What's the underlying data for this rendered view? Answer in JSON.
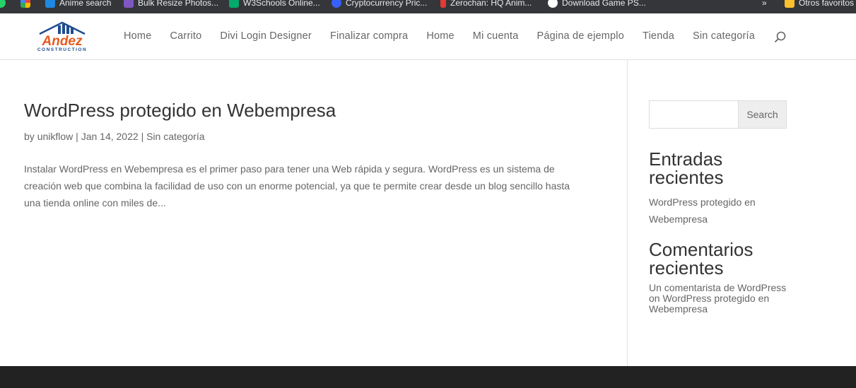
{
  "bookmarks": [
    {
      "icon": "whatsapp-icon",
      "label": "",
      "color": "#25d366"
    },
    {
      "icon": "google-icon",
      "label": "",
      "color": "#ffffff"
    },
    {
      "icon": "anime-search-icon",
      "label": "Anime search",
      "color": "#1e88e5"
    },
    {
      "icon": "bulk-resize-icon",
      "label": "Bulk Resize Photos...",
      "color": "#7e57c2"
    },
    {
      "icon": "w3schools-icon",
      "label": "W3Schools Online...",
      "color": "#04aa6d"
    },
    {
      "icon": "crypto-icon",
      "label": "Cryptocurrency Pric...",
      "color": "#3861fb"
    },
    {
      "icon": "zerochan-icon",
      "label": "Zerochan: HQ Anim...",
      "color": "#e53935"
    },
    {
      "icon": "download-game-icon",
      "label": "Download Game PS...",
      "color": "#ffffff"
    },
    {
      "icon": "folder-icon",
      "label": "Otros favoritos",
      "color": "#fbc02d"
    }
  ],
  "logo": {
    "brand": "Andez",
    "tagline": "CONSTRUCTION",
    "color": "#e85a1c",
    "accent": "#1f4d8f"
  },
  "nav": [
    "Home",
    "Carrito",
    "Divi Login Designer",
    "Finalizar compra",
    "Home",
    "Mi cuenta",
    "Página de ejemplo",
    "Tienda",
    "Sin categoría"
  ],
  "post": {
    "title": "WordPress protegido en Webempresa",
    "author": "unikflow",
    "date": "Jan 14, 2022",
    "category": "Sin categoría",
    "excerpt": "Instalar WordPress en Webempresa es el primer paso para tener una Web rápida y segura. WordPress es un sistema de creación web que combina la facilidad de uso con un enorme potencial, ya que te permite crear desde un blog sencillo hasta una tienda online con miles de..."
  },
  "sidebar": {
    "search_button": "Search",
    "recent_posts_title": "Entradas recientes",
    "recent_post": "WordPress protegido en Webempresa",
    "recent_comments_title": "Comentarios recientes",
    "comment_author": "Un comentarista de WordPress",
    "comment_on": "on",
    "comment_post": "WordPress protegido en Webempresa"
  },
  "meta_labels": {
    "by": "by",
    "sep": "|"
  },
  "colors": {
    "bookmark_bar": "#35363a",
    "footer": "#222222",
    "text": "#666666",
    "heading": "#333333"
  }
}
